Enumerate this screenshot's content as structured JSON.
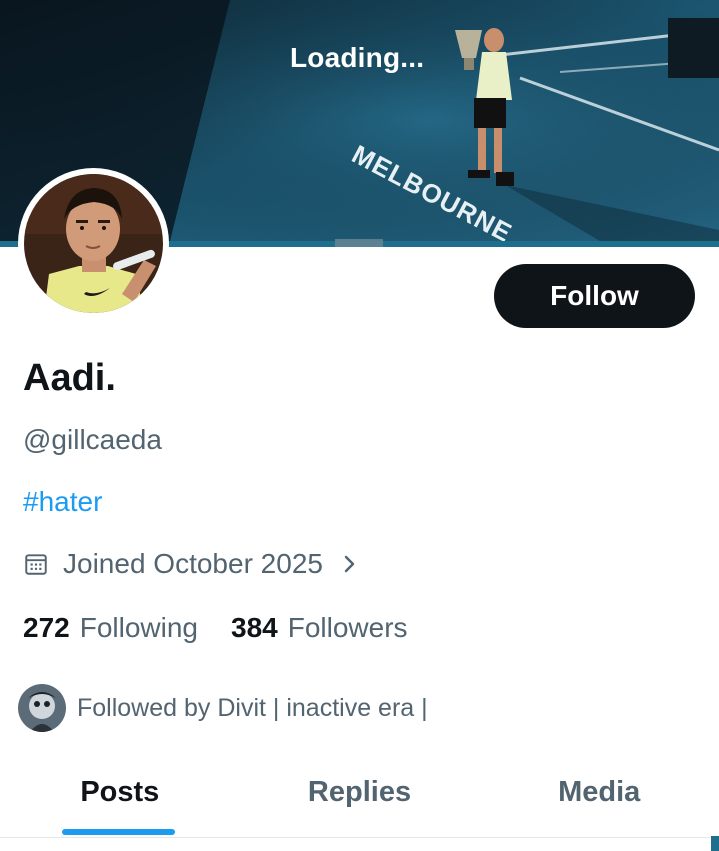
{
  "banner": {
    "loading_text": "Loading..."
  },
  "profile": {
    "display_name": "Aadi.",
    "handle": "@gillcaeda",
    "bio": "#hater",
    "joined": "Joined October 2025",
    "following_count": "272",
    "following_label": "Following",
    "followers_count": "384",
    "followers_label": "Followers",
    "followed_by": "Followed by Divit | inactive era |"
  },
  "actions": {
    "follow_label": "Follow"
  },
  "tabs": [
    {
      "label": "Posts",
      "active": true
    },
    {
      "label": "Replies",
      "active": false
    },
    {
      "label": "Media",
      "active": false
    }
  ],
  "colors": {
    "accent": "#1d9bf0",
    "text": "#0f1419",
    "muted": "#536471",
    "button": "#0f1419"
  },
  "icons": [
    "calendar-icon",
    "chevron-right-icon"
  ]
}
